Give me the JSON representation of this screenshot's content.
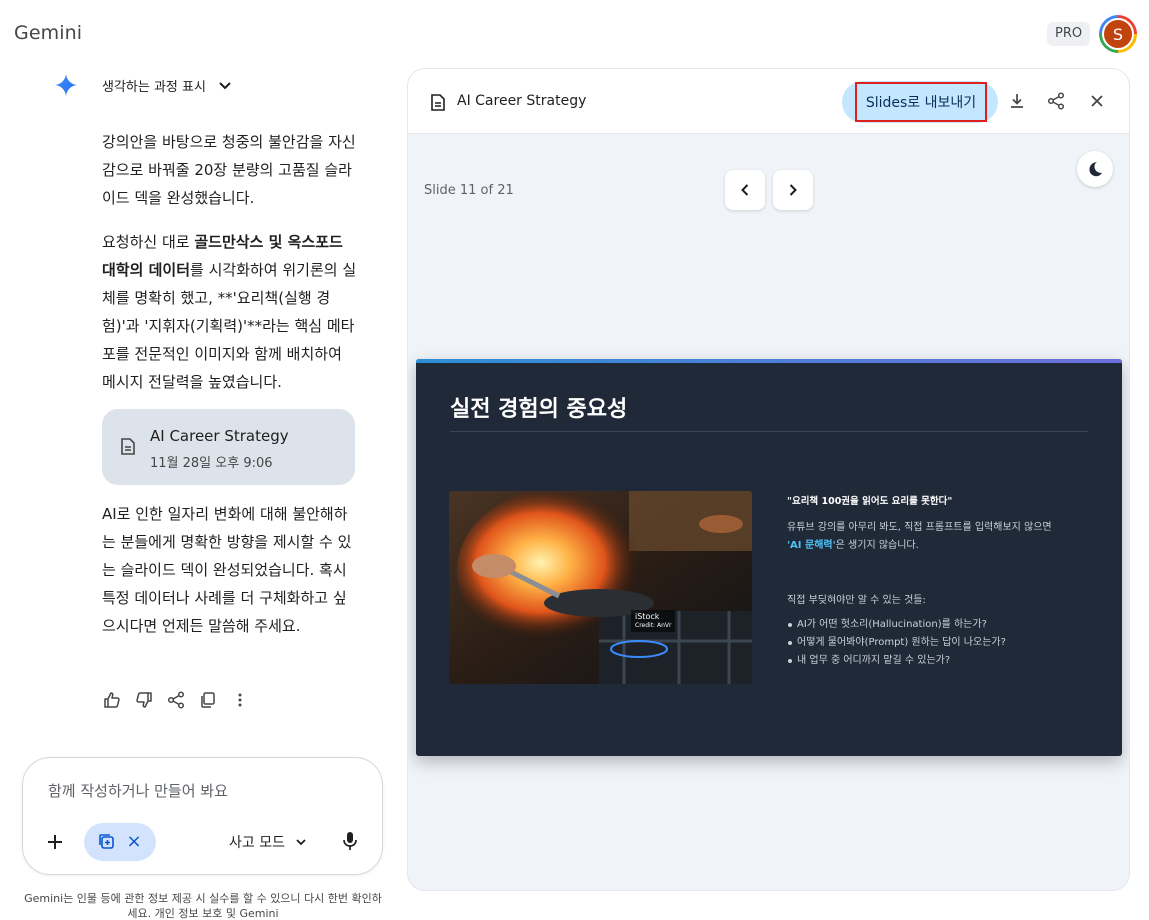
{
  "header": {
    "brand": "Gemini",
    "plan_badge": "PRO",
    "avatar_letter": "S"
  },
  "chat": {
    "thinking_label": "생각하는 과정 표시",
    "para1": "강의안을 바탕으로 청중의 불안감을 자신감으로 바꿔줄 20장 분량의 고품질 슬라이드 덱을 완성했습니다.",
    "para2_prefix": "요청하신 대로 ",
    "para2_bold": "골드만삭스 및 옥스포드 대학의 데이터",
    "para2_suffix": "를 시각화하여 위기론의 실체를 명확히 했고, **'요리책(실행 경험)'과 '지휘자(기획력)'**라는 핵심 메타포를 전문적인 이미지와 함께 배치하여 메시지 전달력을 높였습니다.",
    "doc_card": {
      "title": "AI Career Strategy",
      "date": "11월 28일 오후 9:06"
    },
    "para3": "AI로 인한 일자리 변화에 대해 불안해하는 분들에게 명확한 방향을 제시할 수 있는 슬라이드 덱이 완성되었습니다. 혹시 특정 데이터나 사례를 더 구체화하고 싶으시다면 언제든 말씀해 주세요.",
    "actions": [
      "thumbs-up-icon",
      "thumbs-down-icon",
      "share-icon",
      "copy-icon",
      "more-vert-icon"
    ]
  },
  "composer": {
    "placeholder": "함께 작성하거나 만들어 봐요",
    "mode_label": "사고 모드",
    "tool_chip_close": "×"
  },
  "disclaimer": "Gemini는 인물 등에 관한 정보 제공 시 실수를 할 수 있으니 다시 한번 확인하세요. 개인 정보 보호 및 Gemini",
  "panel": {
    "title": "AI Career Strategy",
    "export_label": "Slides로 내보내기",
    "slide_counter": "Slide 11 of 21",
    "slide": {
      "title": "실전 경험의 중요성",
      "quote": "\"요리책 100권을 읽어도 요리를 못한다\"",
      "body_prefix": "유튜브 강의를 아무리 봐도, 직접 프롬프트를 입력해보지 않으면",
      "body_bold": "'AI 문해력'",
      "body_suffix": "은 생기지 않습니다.",
      "subheading": "직접 부딪혀야만 알 수 있는 것들:",
      "bullets": [
        "AI가 어떤 헛소리(Hallucination)를 하는가?",
        "어떻게 물어봐야(Prompt) 원하는 답이 나오는가?",
        "내 업무 중 어디까지 맡길 수 있는가?"
      ],
      "photo_watermark": "iStock",
      "photo_credit": "Credit: AnVr"
    }
  },
  "colors": {
    "accent": "#c2e7ff",
    "slide_bg": "#1f2937",
    "highlight": "#4fc3f7",
    "export_outline": "#e0201e"
  }
}
